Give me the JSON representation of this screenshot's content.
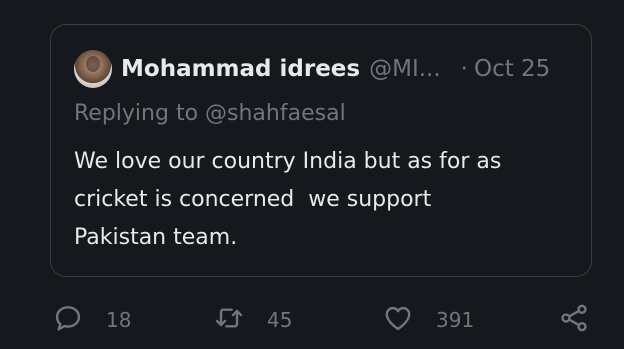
{
  "quote": {
    "author_name": "Mohammad idrees",
    "author_handle": "@MI...",
    "separator": "·",
    "date": "Oct 25",
    "replying_prefix": "Replying to",
    "replying_mention": "@shahfaesal",
    "text": "We love our country India but as for as\ncricket is concerned  we support\nPakistan team."
  },
  "actions": {
    "reply_count": "18",
    "retweet_count": "45",
    "like_count": "391",
    "icons": [
      "reply-icon",
      "retweet-icon",
      "like-icon",
      "share-icon"
    ]
  },
  "colors": {
    "background": "#15181c",
    "primary_text": "#e7e9ea",
    "secondary_text": "#71767b",
    "border": "#3a3d41"
  }
}
